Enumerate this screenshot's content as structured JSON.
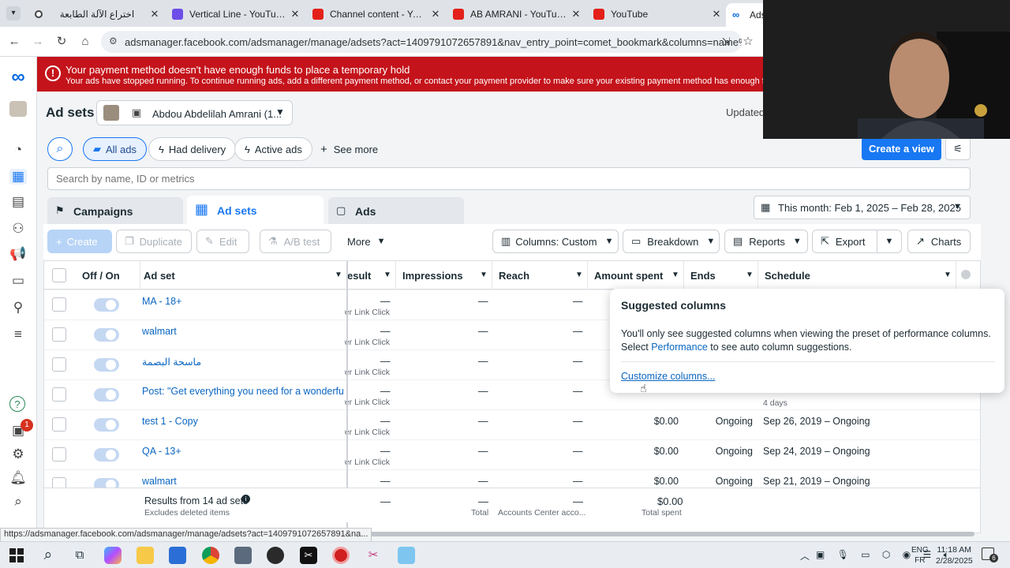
{
  "browser": {
    "tabs": [
      {
        "title": "اختراع الآلة الطابعة",
        "icon": "generic-tab-icon"
      },
      {
        "title": "Vertical Line - YouTube Thu",
        "icon": "shield-tab-icon"
      },
      {
        "title": "Channel content - YouTube",
        "icon": "youtube-icon"
      },
      {
        "title": "AB AMRANI - YouTube",
        "icon": "youtube-icon"
      },
      {
        "title": "YouTube",
        "icon": "youtube-icon"
      },
      {
        "title": "Ads",
        "icon": "meta-icon"
      }
    ],
    "url": "adsmanager.facebook.com/adsmanager/manage/adsets?act=1409791072657891&nav_entry_point=comet_bookmark&columns=name%2Cde..."
  },
  "banner": {
    "title": "Your payment method doesn't have enough funds to place a temporary hold",
    "body": "Your ads have stopped running. To continue running ads, add a different payment method, or contact your payment provider to make sure your existing payment method has enough funds."
  },
  "header": {
    "title": "Ad sets",
    "account": "Abdou Abdelilah Amrani (1...",
    "updated": "Updated"
  },
  "filters": {
    "all_ads": "All ads",
    "had_delivery": "Had delivery",
    "active_ads": "Active ads",
    "see_more": "See more",
    "create_view": "Create a view"
  },
  "search": {
    "placeholder": "Search by name, ID or metrics"
  },
  "levels": {
    "campaigns": "Campaigns",
    "adsets": "Ad sets",
    "ads": "Ads"
  },
  "date_range": "This month: Feb 1, 2025 – Feb 28, 2025",
  "toolbar": {
    "create": "Create",
    "duplicate": "Duplicate",
    "edit": "Edit",
    "ab_test": "A/B test",
    "more": "More",
    "columns": "Columns: Custom",
    "breakdown": "Breakdown",
    "reports": "Reports",
    "export": "Export",
    "charts": "Charts"
  },
  "table": {
    "headers": {
      "offon": "Off / On",
      "adset": "Ad set",
      "result": "esult",
      "impressions": "Impressions",
      "reach": "Reach",
      "amount": "Amount spent",
      "ends": "Ends",
      "schedule": "Schedule"
    },
    "rows": [
      {
        "name": "MA - 18+",
        "result": "—",
        "result_sub": "Per Link Click",
        "impressions": "—",
        "reach": "—",
        "amount": "",
        "ends": "",
        "schedule": "",
        "schedule_sub": ""
      },
      {
        "name": "walmart",
        "result": "—",
        "result_sub": "Per Link Click",
        "impressions": "—",
        "reach": "—",
        "amount": "",
        "ends": "",
        "schedule": "",
        "schedule_sub": ""
      },
      {
        "name": "ماسحة البصمة",
        "result": "—",
        "result_sub": "Per Link Click",
        "impressions": "—",
        "reach": "—",
        "amount": "",
        "ends": "",
        "schedule": "",
        "schedule_sub": ""
      },
      {
        "name": "Post: \"Get everything you need for a wonderful...",
        "result": "—",
        "result_sub": "Per Link Click",
        "impressions": "—",
        "reach": "—",
        "amount": "",
        "ends": "",
        "schedule": "",
        "schedule_sub": "4 days"
      },
      {
        "name": "test 1 - Copy",
        "result": "—",
        "result_sub": "Per Link Click",
        "impressions": "—",
        "reach": "—",
        "amount": "$0.00",
        "ends": "Ongoing",
        "schedule": "Sep 26, 2019 – Ongoing",
        "schedule_sub": ""
      },
      {
        "name": "QA - 13+",
        "result": "—",
        "result_sub": "Per Link Click",
        "impressions": "—",
        "reach": "—",
        "amount": "$0.00",
        "ends": "Ongoing",
        "schedule": "Sep 24, 2019 – Ongoing",
        "schedule_sub": ""
      },
      {
        "name": "walmart",
        "result": "—",
        "result_sub": "",
        "impressions": "—",
        "reach": "—",
        "amount": "$0.00",
        "ends": "Ongoing",
        "schedule": "Sep 21, 2019 – Ongoing",
        "schedule_sub": ""
      }
    ],
    "footer": {
      "results": "Results from 14 ad sets",
      "excludes": "Excludes deleted items",
      "result": "—",
      "impressions": "—",
      "impressions_sub": "Total",
      "reach": "—",
      "reach_sub": "Accounts Center acco...",
      "amount": "$0.00",
      "amount_sub": "Total spent"
    }
  },
  "popup": {
    "title": "Suggested columns",
    "body_before": "You'll only see suggested columns when viewing the preset of performance columns. Select ",
    "body_link": "Performance",
    "body_after": " to see auto column suggestions.",
    "customize": "Customize columns..."
  },
  "leftnav": {
    "badge": "1"
  },
  "status_url": "https://adsmanager.facebook.com/adsmanager/manage/adsets?act=1409791072657891&na...",
  "taskbar": {
    "lang1": "ENG",
    "lang2": "FR",
    "time": "11:18 AM",
    "date": "2/28/2025",
    "notif_count": "6"
  },
  "colors": {
    "banner_red": "#c4131b",
    "primary_blue": "#1877f2",
    "link_blue": "#0a66c2"
  }
}
